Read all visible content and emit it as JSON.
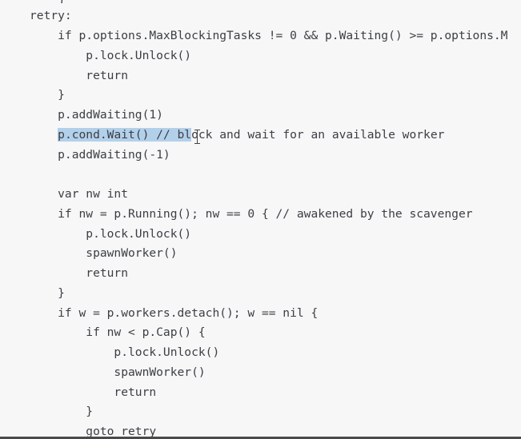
{
  "code": {
    "prev_brace": "}",
    "lines": [
      "retry:",
      "    if p.options.MaxBlockingTasks != 0 && p.Waiting() >= p.options.M",
      "        p.lock.Unlock()",
      "        return",
      "    }",
      "    p.addWaiting(1)",
      "    p.cond.Wait() // block and wait for an available worker",
      "    p.addWaiting(-1)",
      "",
      "    var nw int",
      "    if nw = p.Running(); nw == 0 { // awakened by the scavenger",
      "        p.lock.Unlock()",
      "        spawnWorker()",
      "        return",
      "    }",
      "    if w = p.workers.detach(); w == nil {",
      "        if nw < p.Cap() {",
      "            p.lock.Unlock()",
      "            spawnWorker()",
      "            return",
      "        }",
      "        goto retry"
    ],
    "selection": {
      "line": 6,
      "indent": "    ",
      "selected": "p.cond.Wait() // bl",
      "rest": "ock and wait for an available worker"
    }
  }
}
